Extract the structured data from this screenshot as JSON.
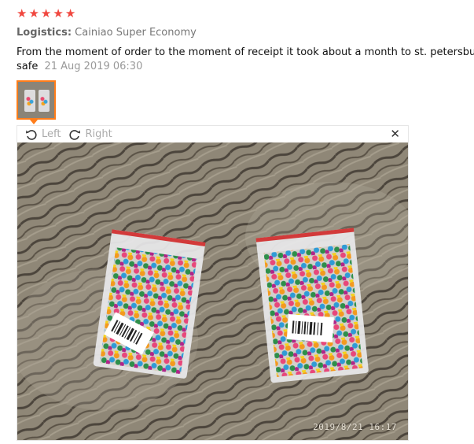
{
  "review": {
    "rating": 5,
    "logistics_label": "Logistics:",
    "logistics_value": "Cainiao Super Economy",
    "text": "From the moment of order to the moment of receipt it took about a month to st. petersburg, eve",
    "text_continued": "safe",
    "date": "21 Aug 2019 06:30"
  },
  "viewer": {
    "rotate_left_label": "Left",
    "rotate_right_label": "Right",
    "photo_timestamp": "2019/8/21  16:17"
  },
  "colors": {
    "star": "#f0473f",
    "thumb_border": "#ff7d1a"
  },
  "icons": {
    "star": "star-icon",
    "rotate_left": "rotate-left-icon",
    "rotate_right": "rotate-right-icon",
    "close": "close-icon"
  }
}
